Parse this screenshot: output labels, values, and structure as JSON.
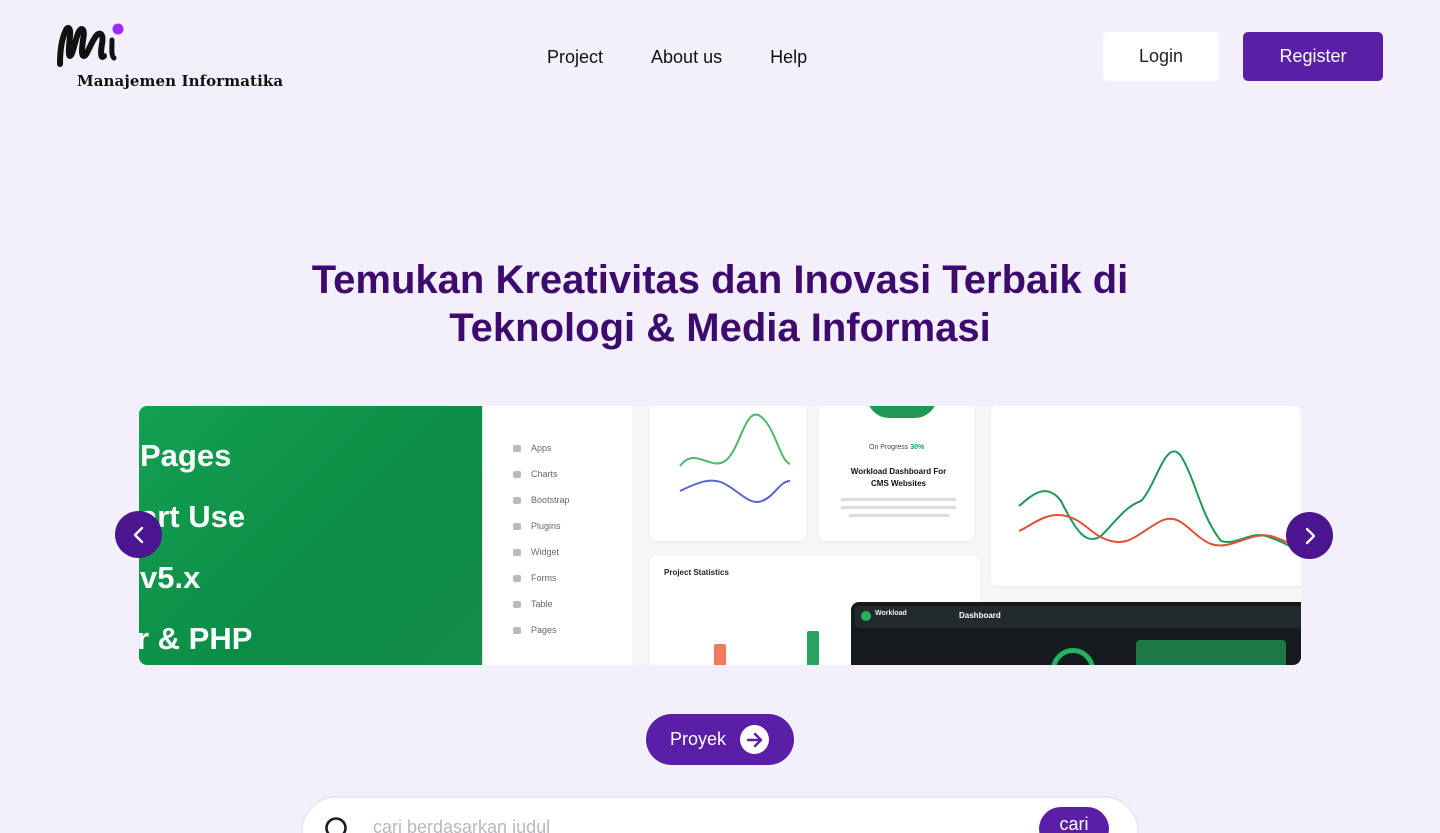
{
  "brand": {
    "name": "Manajemen Informatika",
    "accent": "#5a1fa6",
    "dot_color": "#9b2cf0"
  },
  "nav": {
    "items": [
      {
        "label": "Project"
      },
      {
        "label": "About us"
      },
      {
        "label": "Help"
      }
    ]
  },
  "auth": {
    "login_label": "Login",
    "register_label": "Register"
  },
  "hero": {
    "title_line1": "Temukan Kreativitas dan Inovasi Terbaik di",
    "title_line2": "Teknologi & Media Informasi",
    "title_color": "#3d0a6e"
  },
  "carousel": {
    "slide": {
      "banner_lines": [
        "Pages",
        "art Use",
        "v5.x",
        "r & PHP"
      ],
      "sidebar_items": [
        "Apps",
        "Charts",
        "Bootstrap",
        "Plugins",
        "Widget",
        "Forms",
        "Table",
        "Pages"
      ],
      "card_progress_label": "On Progress",
      "card_progress_value": "30%",
      "card_title": "Workload Dashboard For CMS Websites",
      "panel_project_statistics": "Project Statistics",
      "dark_panel_title": "Workload",
      "dark_panel_tab": "Dashboard"
    },
    "prev_icon": "chevron-left-icon",
    "next_icon": "chevron-right-icon"
  },
  "cta": {
    "proyek_label": "Proyek",
    "icon": "arrow-right-icon"
  },
  "search": {
    "placeholder": "cari berdasarkan judul",
    "value": "",
    "button_label": "cari",
    "icon": "search-icon"
  }
}
